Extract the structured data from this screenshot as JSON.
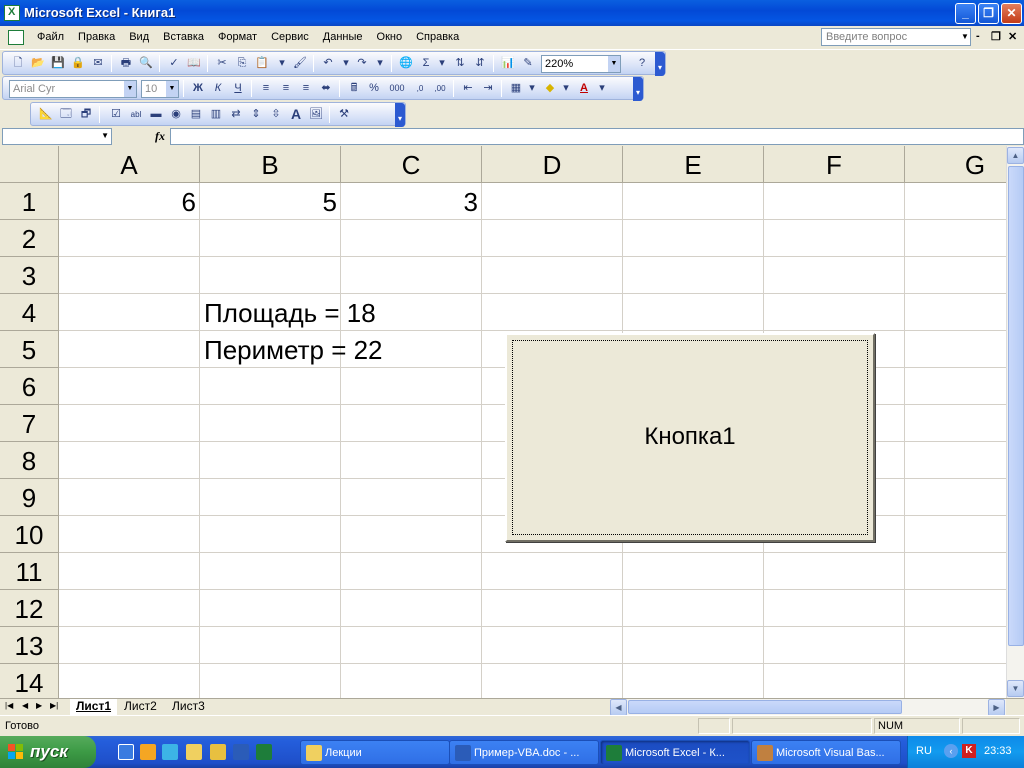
{
  "window": {
    "title": "Microsoft Excel - Книга1"
  },
  "menu": {
    "items": [
      "Файл",
      "Правка",
      "Вид",
      "Вставка",
      "Формат",
      "Сервис",
      "Данные",
      "Окно",
      "Справка"
    ],
    "help_placeholder": "Введите вопрос"
  },
  "toolbar": {
    "zoom": "220%",
    "font_name": "Arial Cyr",
    "font_size": "10",
    "bold_label": "Ж",
    "italic_label": "К",
    "underline_label": "Ч",
    "currency_label": "%",
    "thousands_label": "000",
    "sum_label": "Σ",
    "text_a_label": "A"
  },
  "formula_bar": {
    "fx_label": "fx",
    "name_value": "",
    "formula_value": ""
  },
  "grid": {
    "columns": [
      "A",
      "B",
      "C",
      "D",
      "E",
      "F",
      "G"
    ],
    "rows": [
      "1",
      "2",
      "3",
      "4",
      "5",
      "6",
      "7",
      "8",
      "9",
      "10",
      "11",
      "12",
      "13",
      "14"
    ],
    "cells": {
      "A1": "6",
      "B1": "5",
      "C1": "3",
      "B4": "Площадь = 18",
      "B5": "Периметр = 22"
    }
  },
  "button": {
    "label": "Кнопка1"
  },
  "sheets": [
    "Лист1",
    "Лист2",
    "Лист3"
  ],
  "active_sheet": "Лист1",
  "status": {
    "text": "Готово",
    "num": "NUM"
  },
  "taskbar": {
    "start_label": "пуск",
    "tasks": [
      "Лекции",
      "Пример-VBA.doc - ...",
      "Microsoft Excel - К...",
      "Microsoft Visual Bas..."
    ],
    "active_task_index": 2,
    "lang": "RU",
    "clock": "23:33"
  }
}
